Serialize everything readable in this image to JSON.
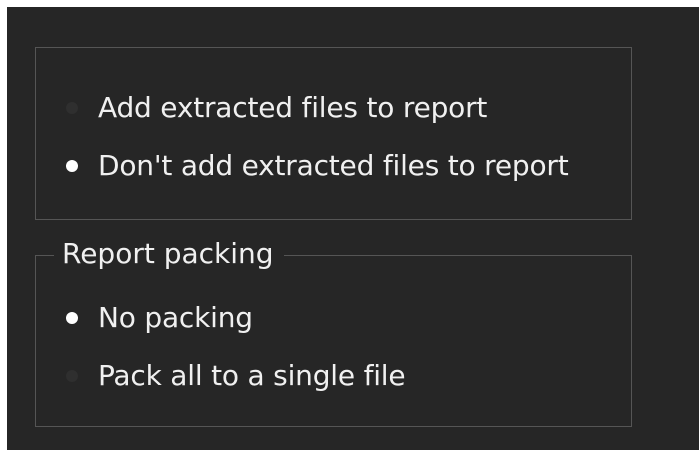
{
  "colors": {
    "panel_background": "#262626",
    "group_border": "#555555",
    "text": "#f0f0f0",
    "radio_selected": "#ffffff",
    "radio_unselected": "#2f2f2f"
  },
  "extracted_files_group": {
    "options": [
      {
        "label": "Add extracted files to report",
        "selected": false
      },
      {
        "label": "Don't add extracted files to report",
        "selected": true
      }
    ]
  },
  "report_packing_group": {
    "title": "Report packing",
    "options": [
      {
        "label": "No packing",
        "selected": true
      },
      {
        "label": "Pack all to a single file",
        "selected": false
      }
    ]
  }
}
